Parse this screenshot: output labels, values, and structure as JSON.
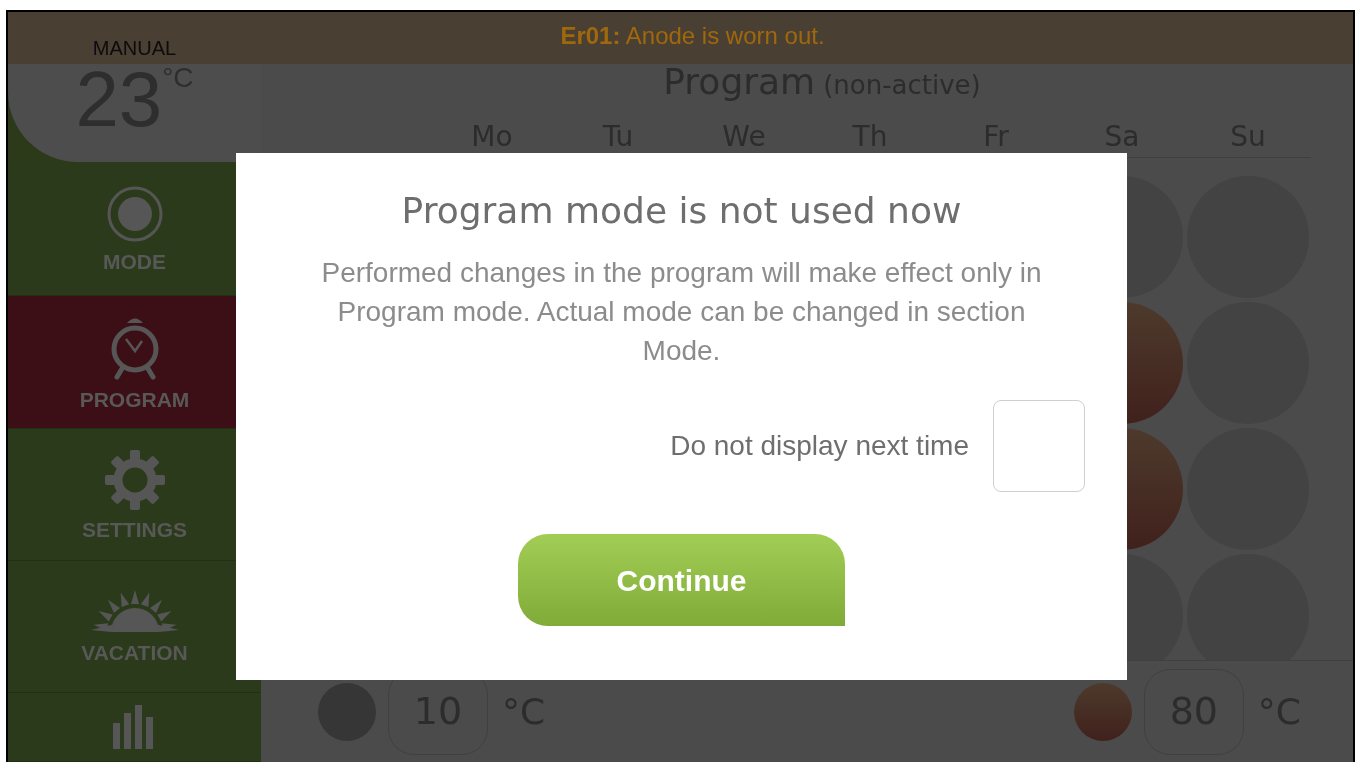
{
  "error_banner": {
    "code": "Er01:",
    "message": "Anode is worn out."
  },
  "sidebar": {
    "mode_label": "MANUAL",
    "temperature": "23",
    "unit": "°C",
    "items": [
      {
        "kind": "mode",
        "label": "MODE",
        "selected": false
      },
      {
        "kind": "program",
        "label": "PROGRAM",
        "selected": true
      },
      {
        "kind": "settings",
        "label": "SETTINGS",
        "selected": false
      },
      {
        "kind": "vacation",
        "label": "VACATION",
        "selected": false
      },
      {
        "kind": "statistics",
        "selected": false
      }
    ]
  },
  "program": {
    "title": "Program",
    "status": "(non-active)",
    "days": [
      "Mo",
      "Tu",
      "We",
      "Th",
      "Fr",
      "Sa",
      "Su"
    ],
    "visible_slot_columns": [
      {
        "active": [
          false,
          true,
          true,
          false
        ]
      },
      {
        "active": [
          false,
          false,
          false,
          false
        ]
      }
    ]
  },
  "range": {
    "min": {
      "value": "10",
      "unit": "°C"
    },
    "max": {
      "value": "80",
      "unit": "°C"
    }
  },
  "dialog": {
    "title": "Program mode is not used now",
    "message": "Performed changes in the program will make effect only in Program mode. Actual mode can be changed in section Mode.",
    "checkbox": {
      "label": "Do not display next time",
      "checked": false
    },
    "button": "Continue"
  }
}
